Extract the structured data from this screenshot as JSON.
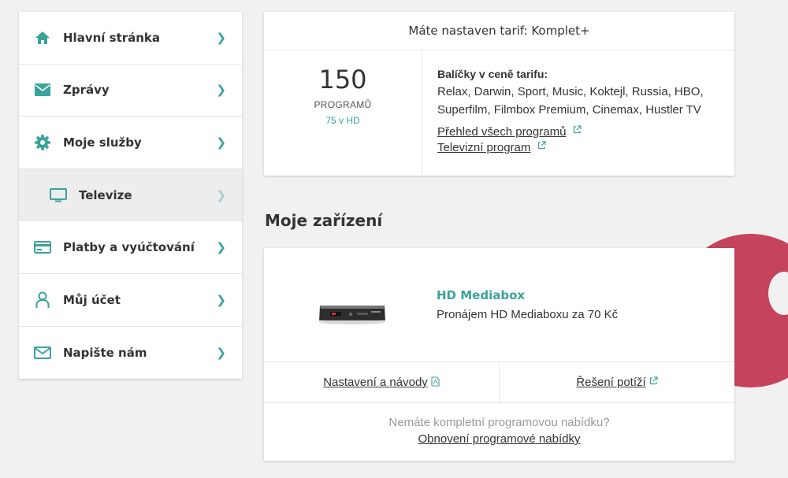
{
  "colors": {
    "accent": "#3aa39a",
    "decor": "#c6435e"
  },
  "sidebar": {
    "items": [
      {
        "label": "Hlavní stránka",
        "icon": "home-icon"
      },
      {
        "label": "Zprávy",
        "icon": "mail-icon"
      },
      {
        "label": "Moje služby",
        "icon": "gear-icon"
      },
      {
        "label": "Televize",
        "icon": "tv-icon"
      },
      {
        "label": "Platby a vyúčtování",
        "icon": "credit-card-icon"
      },
      {
        "label": "Můj účet",
        "icon": "user-icon"
      },
      {
        "label": "Napište nám",
        "icon": "envelope-icon"
      }
    ],
    "chevron": "❯"
  },
  "tariff": {
    "heading": "Máte nastaven tarif: Komplet+",
    "count": "150",
    "count_label": "PROGRAMŮ",
    "hd_label": "75 v HD",
    "packages_title": "Balíčky v ceně tarifu:",
    "packages_list": "Relax, Darwin, Sport, Music, Koktejl, Russia, HBO, Superfilm, Filmbox Premium, Cinemax, Hustler TV",
    "link_overview": "Přehled všech programů",
    "link_tv_program": "Televizní program"
  },
  "devices": {
    "section_title": "Moje zařízení",
    "device_name": "HD Mediabox",
    "device_desc": "Pronájem HD Mediaboxu za 70 Kč",
    "link_settings": "Nastavení a návody",
    "link_troubleshoot": "Řešení potíží",
    "footer_question": "Nemáte kompletní programovou nabídku?",
    "footer_link": "Obnovení programové nabídky"
  }
}
